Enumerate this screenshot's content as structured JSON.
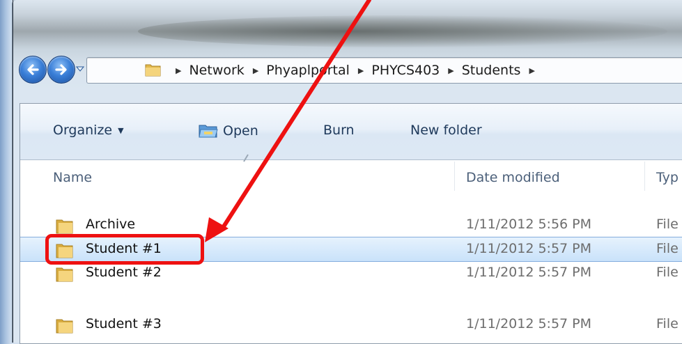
{
  "window": {
    "title": ""
  },
  "nav": {
    "back_icon": "back-arrow-icon",
    "forward_icon": "forward-arrow-icon",
    "history_icon": "chevron-down-icon"
  },
  "address": {
    "breadcrumbs": [
      "Network",
      "Phyaplportal",
      "PHYCS403",
      "Students"
    ],
    "folder_icon": "folder-icon"
  },
  "toolbar": {
    "organize_label": "Organize",
    "open_label": "Open",
    "burn_label": "Burn",
    "new_folder_label": "New folder"
  },
  "columns": {
    "name": "Name",
    "date_modified": "Date modified",
    "type": "Typ"
  },
  "files": [
    {
      "name": "Archive",
      "date": "1/11/2012 5:56 PM",
      "type": "File"
    },
    {
      "name": "Student #1",
      "date": "1/11/2012 5:57 PM",
      "type": "File",
      "selected": true
    },
    {
      "name": "Student #2",
      "date": "1/11/2012 5:57 PM",
      "type": "File"
    },
    {
      "name": "Student #3",
      "date": "1/11/2012 5:57 PM",
      "type": "File"
    }
  ],
  "annotation": {
    "color": "#ee1111",
    "target": "Student #1"
  },
  "colors": {
    "selection": "#c9e2fa",
    "toolbar_text": "#1e395b",
    "header_text": "#4c607a"
  }
}
